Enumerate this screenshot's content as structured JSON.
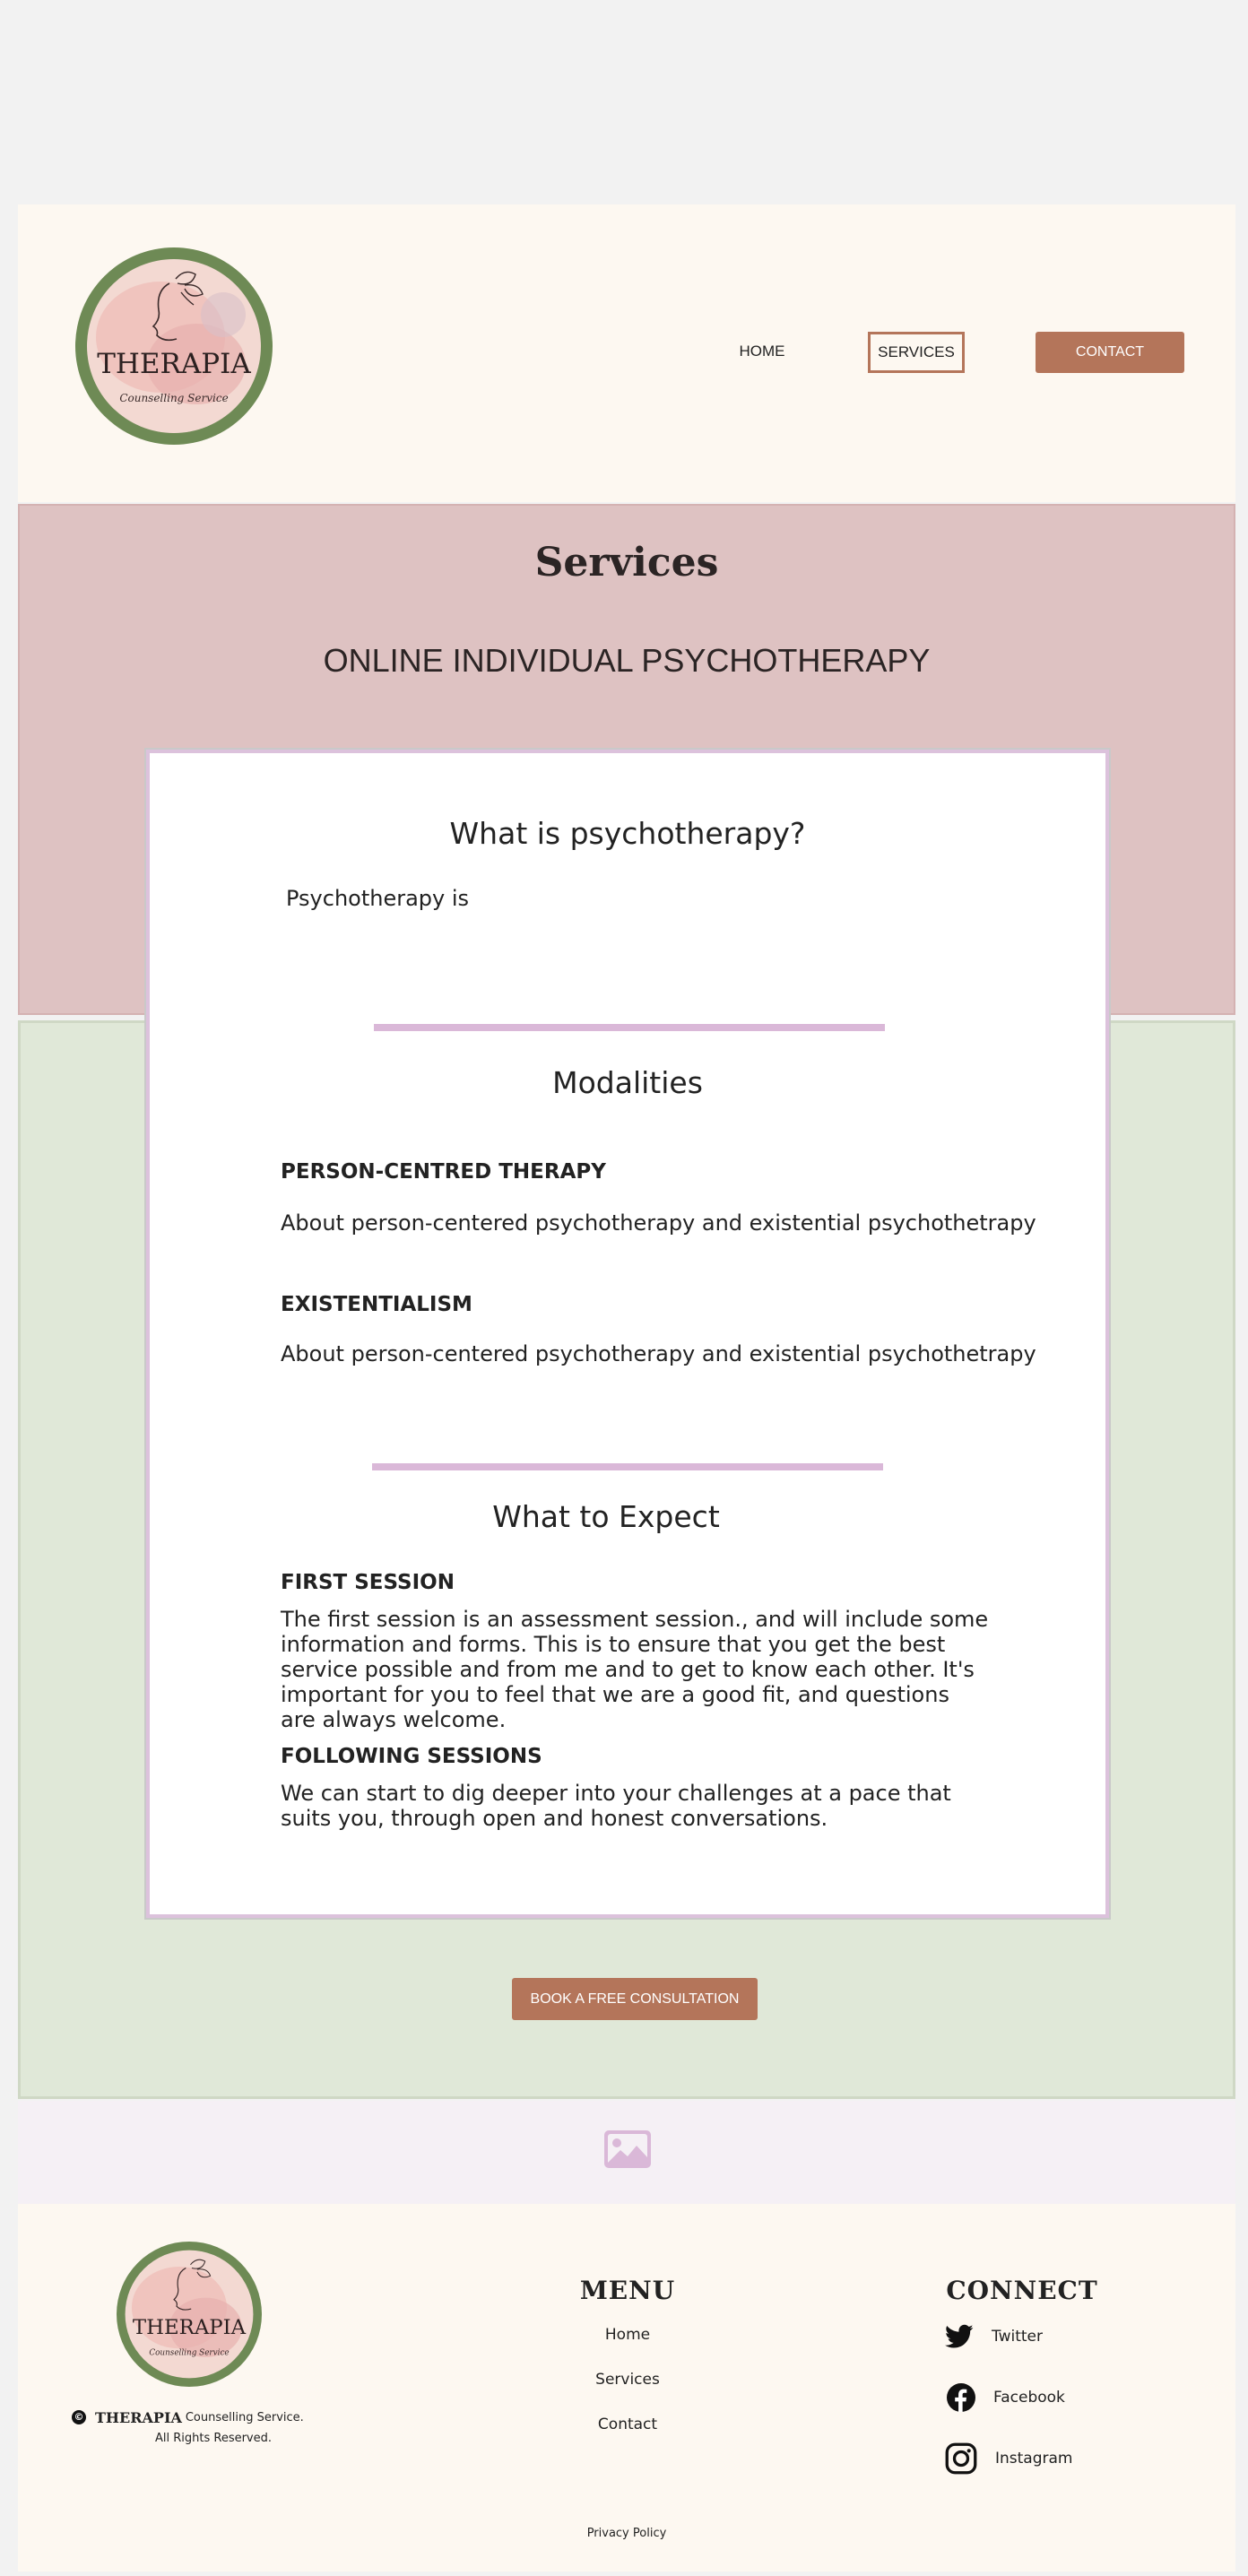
{
  "header": {
    "logo_text": "THERAPIA",
    "logo_tagline": "Counselling Service",
    "nav": {
      "home": "HOME",
      "services": "SERVICES",
      "contact": "CONTACT"
    }
  },
  "hero": {
    "title": "Services",
    "subtitle": "ONLINE INDIVIDUAL PSYCHOTHERAPY"
  },
  "card": {
    "section1": {
      "heading": "What is psychotherapy?",
      "body": "Psychotherapy is"
    },
    "section2": {
      "heading": "Modalities",
      "items": [
        {
          "title": "PERSON-CENTRED THERAPY",
          "body": "About person-centered psychotherapy and existential psychothetrapy"
        },
        {
          "title": "EXISTENTIALISM",
          "body": "About person-centered psychotherapy and existential psychothetrapy"
        }
      ]
    },
    "section3": {
      "heading": "What to Expect",
      "items": [
        {
          "title": "FIRST SESSION",
          "body": "The first session is an assessment session., and will include some information and forms. This is to ensure that you get the best service possible and from me and to get to know each other. It's important for you to feel that we are a good fit, and questions are always welcome."
        },
        {
          "title": "FOLLOWING SESSIONS",
          "body": "We can start to dig deeper into your challenges at a pace that suits you, through open and honest conversations."
        }
      ]
    }
  },
  "cta": {
    "book_label": "BOOK A FREE CONSULTATION"
  },
  "footer": {
    "copyright_symbol": "©",
    "brand": "THERAPIA",
    "brand_suffix": "Counselling Service.",
    "rights": "All Rights Reserved.",
    "menu": {
      "heading": "MENU",
      "links": [
        "Home",
        "Services",
        "Contact"
      ]
    },
    "connect": {
      "heading": "CONNECT",
      "links": [
        {
          "label": "Twitter",
          "icon": "twitter-icon"
        },
        {
          "label": "Facebook",
          "icon": "facebook-icon"
        },
        {
          "label": "Instagram",
          "icon": "instagram-icon"
        }
      ]
    },
    "privacy": "Privacy Policy"
  },
  "colors": {
    "accent": "#b4755a",
    "pink_section": "#dec2c2",
    "green_section": "#e0e8d8",
    "divider": "#dab8d8",
    "cream": "#fdf8f1",
    "logo_ring": "#6e8a55"
  }
}
